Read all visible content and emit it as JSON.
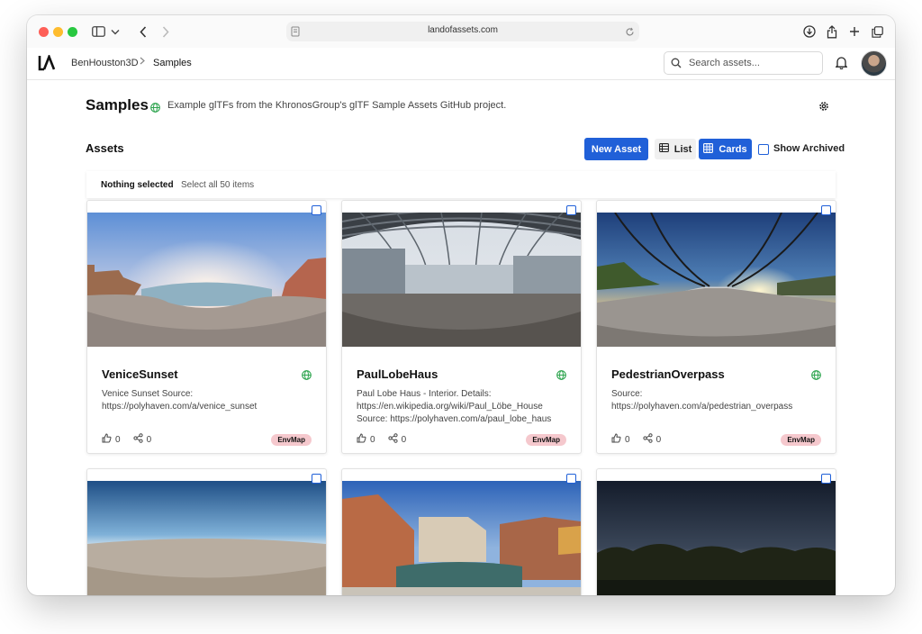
{
  "browser": {
    "url": "landofassets.com",
    "icons": [
      "sidebar-icon",
      "chevron-down-icon",
      "back-icon",
      "forward-icon",
      "page-icon",
      "reload-icon",
      "download-icon",
      "share-icon",
      "new-tab-icon",
      "tabs-icon"
    ]
  },
  "header": {
    "logo": "LA",
    "breadcrumb": [
      "BenHouston3D",
      "Samples"
    ],
    "search_placeholder": "Search assets..."
  },
  "page": {
    "title": "Samples",
    "description": "Example glTFs from the KhronosGroup's glTF Sample Assets GitHub project."
  },
  "toolbar": {
    "heading": "Assets",
    "new_asset": "New Asset",
    "list": "List",
    "cards": "Cards",
    "show_archived": "Show Archived"
  },
  "selection": {
    "status": "Nothing selected",
    "select_all": "Select all 50 items"
  },
  "cards": [
    {
      "title": "VeniceSunset",
      "desc": [
        "Venice Sunset Source:",
        "https://polyhaven.com/a/venice_sunset"
      ],
      "likes": "0",
      "shares": "0",
      "tag": "EnvMap"
    },
    {
      "title": "PaulLobeHaus",
      "desc": [
        "Paul Lobe Haus - Interior. Details:",
        "https://en.wikipedia.org/wiki/Paul_Löbe_House",
        "Source: https://polyhaven.com/a/paul_lobe_haus"
      ],
      "likes": "0",
      "shares": "0",
      "tag": "EnvMap"
    },
    {
      "title": "PedestrianOverpass",
      "desc": [
        "Source:",
        "https://polyhaven.com/a/pedestrian_overpass"
      ],
      "likes": "0",
      "shares": "0",
      "tag": "EnvMap"
    }
  ],
  "colors": {
    "accent": "#2060d8",
    "tag_bg": "#f5c8cd",
    "globe": "#2da44e"
  }
}
